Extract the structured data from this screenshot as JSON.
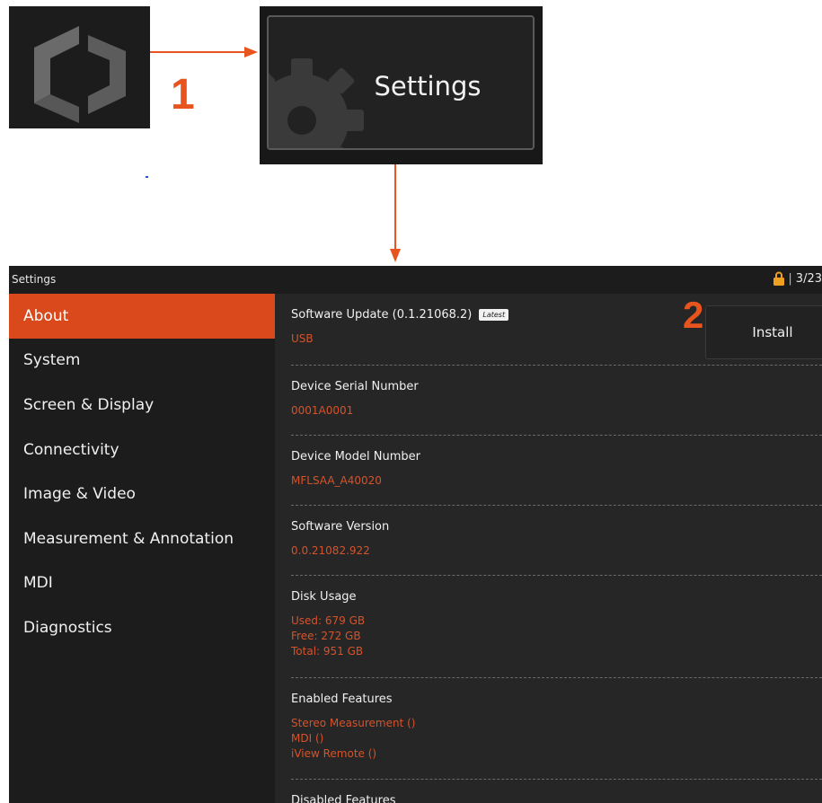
{
  "annotations": {
    "step1": "1",
    "step2": "2"
  },
  "settings_tile": {
    "label": "Settings"
  },
  "window": {
    "title": "Settings",
    "status_time": "3/23"
  },
  "sidebar": {
    "items": [
      {
        "label": "About",
        "active": true
      },
      {
        "label": "System"
      },
      {
        "label": "Screen & Display"
      },
      {
        "label": "Connectivity"
      },
      {
        "label": "Image & Video"
      },
      {
        "label": "Measurement & Annotation"
      },
      {
        "label": "MDI"
      },
      {
        "label": "Diagnostics"
      }
    ]
  },
  "about": {
    "software_update": {
      "title": "Software Update (0.1.21068.2)",
      "badge": "Latest",
      "value": "USB",
      "install_label": "Install"
    },
    "serial": {
      "title": "Device Serial Number",
      "value": "0001A0001"
    },
    "model": {
      "title": "Device Model Number",
      "value": "MFLSAA_A40020"
    },
    "version": {
      "title": "Software Version",
      "value": "0.0.21082.922"
    },
    "disk": {
      "title": "Disk Usage",
      "used": "Used: 679 GB",
      "free": "Free: 272 GB",
      "total": "Total: 951 GB"
    },
    "enabled": {
      "title": "Enabled Features",
      "items": [
        "Stereo Measurement ()",
        "MDI ()",
        "iView Remote ()"
      ]
    },
    "disabled": {
      "title": "Disabled Features"
    }
  },
  "colors": {
    "accent": "#d9491b",
    "value_text": "#d4532b",
    "annotation": "#e8541e"
  },
  "icons": {
    "app": "app-logo-icon",
    "gear": "gear-icon",
    "lock": "lock-icon"
  }
}
